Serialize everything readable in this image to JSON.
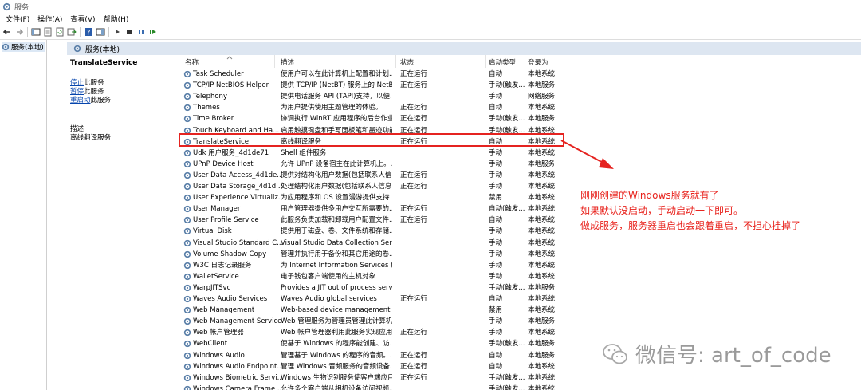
{
  "window": {
    "title": "服务"
  },
  "menu": [
    "文件(F)",
    "操作(A)",
    "查看(V)",
    "帮助(H)"
  ],
  "tree": {
    "root_label": "服务(本地)"
  },
  "panel_header": "服务(本地)",
  "detail": {
    "service_name": "TranslateService",
    "action_stop_link": "停止",
    "action_stop_rest": "此服务",
    "action_pause_link": "暂停",
    "action_pause_rest": "此服务",
    "action_restart_link": "重启动",
    "action_restart_rest": "此服务",
    "desc_label": "描述:",
    "desc_value": "离线翻译服务"
  },
  "columns": {
    "name": "名称",
    "desc": "描述",
    "status": "状态",
    "startup": "启动类型",
    "logon": "登录为"
  },
  "rows": [
    {
      "name": "Task Scheduler",
      "desc": "使用户可以在此计算机上配置和计划...",
      "status": "正在运行",
      "startup": "自动",
      "logon": "本地系统"
    },
    {
      "name": "TCP/IP NetBIOS Helper",
      "desc": "提供 TCP/IP (NetBT) 服务上的 NetB...",
      "status": "正在运行",
      "startup": "手动(触发...",
      "logon": "本地服务"
    },
    {
      "name": "Telephony",
      "desc": "提供电话服务 API (TAPI)支持，以便...",
      "status": "",
      "startup": "手动",
      "logon": "网络服务"
    },
    {
      "name": "Themes",
      "desc": "为用户提供使用主题管理的体验。",
      "status": "正在运行",
      "startup": "自动",
      "logon": "本地系统"
    },
    {
      "name": "Time Broker",
      "desc": "协调执行 WinRT 应用程序的后台作业...",
      "status": "正在运行",
      "startup": "手动(触发...",
      "logon": "本地服务"
    },
    {
      "name": "Touch Keyboard and Ha...",
      "desc": "启用触摸键盘和手写面板笔和墨迹功能",
      "status": "正在运行",
      "startup": "手动(触发...",
      "logon": "本地系统"
    },
    {
      "name": "TranslateService",
      "desc": "离线翻译服务",
      "status": "正在运行",
      "startup": "自动",
      "logon": "本地系统"
    },
    {
      "name": "Udk 用户服务_4d1de71",
      "desc": "Shell 组件服务",
      "status": "",
      "startup": "手动",
      "logon": "本地系统"
    },
    {
      "name": "UPnP Device Host",
      "desc": "允许 UPnP 设备宿主在此计算机上。...",
      "status": "",
      "startup": "手动",
      "logon": "本地服务"
    },
    {
      "name": "User Data Access_4d1de...",
      "desc": "提供对结构化用户数据(包括联系人信...",
      "status": "正在运行",
      "startup": "手动",
      "logon": "本地系统"
    },
    {
      "name": "User Data Storage_4d1d...",
      "desc": "处理结构化用户数据(包括联系人信息...",
      "status": "正在运行",
      "startup": "手动",
      "logon": "本地系统"
    },
    {
      "name": "User Experience Virtualiz...",
      "desc": "为应用程序和 OS 设置漫游提供支持",
      "status": "",
      "startup": "禁用",
      "logon": "本地系统"
    },
    {
      "name": "User Manager",
      "desc": "用户管理器提供多用户交互所需要的...",
      "status": "正在运行",
      "startup": "自动(触发...",
      "logon": "本地系统"
    },
    {
      "name": "User Profile Service",
      "desc": "此服务负责加载和卸载用户配置文件...",
      "status": "正在运行",
      "startup": "自动",
      "logon": "本地系统"
    },
    {
      "name": "Virtual Disk",
      "desc": "提供用于磁盘、卷、文件系统和存储...",
      "status": "",
      "startup": "手动",
      "logon": "本地系统"
    },
    {
      "name": "Visual Studio Standard C...",
      "desc": "Visual Studio Data Collection Servi...",
      "status": "",
      "startup": "手动",
      "logon": "本地系统"
    },
    {
      "name": "Volume Shadow Copy",
      "desc": "管理并执行用于备份和其它用途的卷...",
      "status": "",
      "startup": "手动",
      "logon": "本地系统"
    },
    {
      "name": "W3C 日志记录服务",
      "desc": "为 Internet Information Services (I...",
      "status": "",
      "startup": "手动",
      "logon": "本地系统"
    },
    {
      "name": "WalletService",
      "desc": "电子钱包客户端使用的主机对象",
      "status": "",
      "startup": "手动",
      "logon": "本地系统"
    },
    {
      "name": "WarpJITSvc",
      "desc": "Provides a JIT out of process servi...",
      "status": "",
      "startup": "手动(触发...",
      "logon": "本地服务"
    },
    {
      "name": "Waves Audio Services",
      "desc": "Waves Audio global services",
      "status": "正在运行",
      "startup": "自动",
      "logon": "本地系统"
    },
    {
      "name": "Web Management",
      "desc": "Web-based device management s...",
      "status": "",
      "startup": "禁用",
      "logon": "本地系统"
    },
    {
      "name": "Web Management Service",
      "desc": "Web 管理服务为管理员管理此计算机...",
      "status": "",
      "startup": "手动",
      "logon": "本地服务"
    },
    {
      "name": "Web 帐户管理器",
      "desc": "Web 帐户管理器利用此服务实现应用...",
      "status": "正在运行",
      "startup": "手动",
      "logon": "本地系统"
    },
    {
      "name": "WebClient",
      "desc": "使基于 Windows 的程序能创建、访...",
      "status": "",
      "startup": "手动(触发...",
      "logon": "本地服务"
    },
    {
      "name": "Windows Audio",
      "desc": "管理基于 Windows 的程序的音频。...",
      "status": "正在运行",
      "startup": "自动",
      "logon": "本地服务"
    },
    {
      "name": "Windows Audio Endpoint...",
      "desc": "管理 Windows 音频服务的音频设备...",
      "status": "正在运行",
      "startup": "自动",
      "logon": "本地系统"
    },
    {
      "name": "Windows Biometric Servi...",
      "desc": "Windows 生物识别服务使客户端应用...",
      "status": "正在运行",
      "startup": "手动(触发...",
      "logon": "本地系统"
    },
    {
      "name": "Windows Camera Frame ...",
      "desc": "允许多个客户端从相机设备访问视频...",
      "status": "",
      "startup": "手动(触发...",
      "logon": "本地系统"
    }
  ],
  "annotation": {
    "line1": "刚刚创建的Windows服务就有了",
    "line2": "如果默认没启动，手动启动一下即可。",
    "line3": "做成服务，服务器重启也会跟着重启，不担心挂掉了"
  },
  "watermark": "微信号: art_of_code",
  "colors": {
    "highlight": "#e52320",
    "annotation": "#e8221c",
    "header_bg": "#dde6f1"
  }
}
